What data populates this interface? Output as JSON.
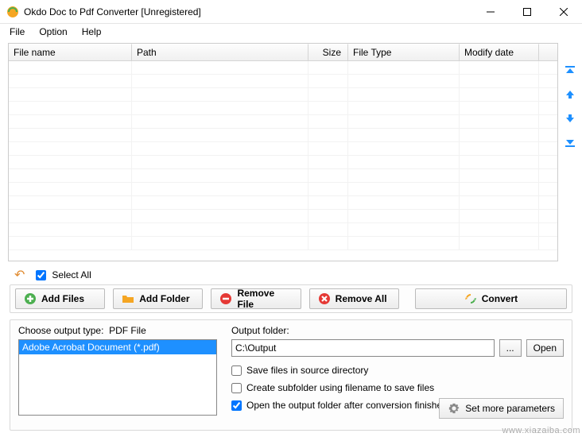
{
  "window": {
    "title": "Okdo Doc to Pdf Converter [Unregistered]"
  },
  "menu": {
    "file": "File",
    "option": "Option",
    "help": "Help"
  },
  "columns": [
    "File name",
    "Path",
    "Size",
    "File Type",
    "Modify date"
  ],
  "select_all": "Select All",
  "buttons": {
    "add_files": "Add Files",
    "add_folder": "Add Folder",
    "remove_file": "Remove File",
    "remove_all": "Remove All",
    "convert": "Convert",
    "browse": "...",
    "open": "Open",
    "set_params": "Set more parameters"
  },
  "output": {
    "type_label": "Choose output type:",
    "type_value": "PDF File",
    "type_list_item": "Adobe Acrobat Document (*.pdf)",
    "folder_label": "Output folder:",
    "folder_path": "C:\\Output",
    "opt_save_in_source": "Save files in source directory",
    "opt_subfolder": "Create subfolder using filename to save files",
    "opt_open_after": "Open the output folder after conversion finished"
  },
  "watermark": "www.xiazaiba.com"
}
